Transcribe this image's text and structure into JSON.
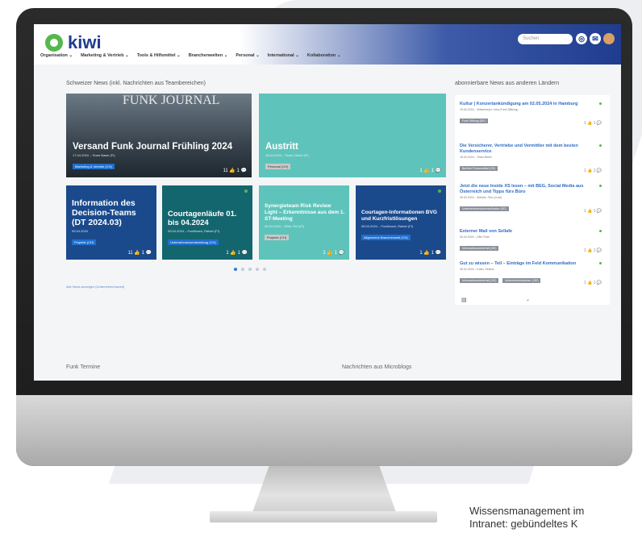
{
  "app": {
    "name": "kiwi"
  },
  "header": {
    "search_placeholder": "Suchen",
    "nav": [
      "Organisation ⌄",
      "Marketing & Vertrieb ⌄",
      "Tools & Hilfsmittel ⌄",
      "Branchenwelten ⌄",
      "Personal ⌄",
      "International ⌄",
      "Kollaboration ⌄"
    ]
  },
  "main": {
    "news_title": "Schweizer News (inkl. Nachrichten aus Teambereichen)",
    "featured": [
      {
        "title": "Versand Funk Journal Frühling 2024",
        "meta": "17.04.2024 – Team Basel (FI)",
        "tag": "Marketing & Vertrieb (CH)",
        "actions": "11 👍  1 💬",
        "image_text": "FUNK JOURNAL"
      },
      {
        "title": "Austritt",
        "meta": "18.04.2024 – Team Zürich (FI)",
        "tag": "Personal (CH)",
        "actions": "1 👍  1 💬"
      }
    ],
    "small_tiles": [
      {
        "title": "Information des Decision-Teams (DT 2024.03)",
        "meta": "09.04.2024",
        "tag": "Projekte (CH)",
        "actions": "11 👍  1 💬"
      },
      {
        "title": "Courtagenläufe 01. bis 04.2024",
        "meta": "09.04.2024 – Fuchlbach, Rafael (FI)",
        "tag": "Unternehmensentwicklung (CH)",
        "actions": "1 👍  1 💬"
      },
      {
        "title": "Synergieteam Risk Review Light – Erkenntnisse aus dem 1. ST-Meeting",
        "meta": "05.04.2024 – Elliot, Ruf (FI)",
        "tag": "Projekte (CH)",
        "actions": "1 👍  1 💬"
      },
      {
        "title": "Courtagen-Informationen BVG und Kurzfristlösungen",
        "meta": "08.04.2024 – Fuchlbach, Rafael (FI)",
        "tag": "Allgemeine Branchenwelt (CH)",
        "actions": "1 👍  1 💬"
      }
    ],
    "all_news_link": "Alle News anzeigen (Unternehmensweit)",
    "footer_left": "Funk Termine",
    "footer_right": "Nachrichten aus Microblogs"
  },
  "sidebar": {
    "title": "abonnierbare News aus anderen Ländern",
    "items": [
      {
        "title": "Kultur | Konzertankündigung am 02.05.2024 in Hamburg",
        "meta": "15.04.2024 – Wintemeyer, Ines (Funk Stiftung)",
        "tag": "Funk Stiftung (DE)",
        "actions": "1 👍  1 💬"
      },
      {
        "title": "Die Versicherer, Vertriebe und Vermittler mit dem besten Kundenservice",
        "meta": "18.04.2024 – Team Berlin",
        "tag": "Berliner Presseartikel (DE)",
        "actions": "1 👍  1 💬"
      },
      {
        "title": "Jetzt die neue Inside XS lesen – mit BEG, Social Media aus Österreich und Tipps fürs Büro",
        "meta": "05.04.2024 – Meinke, Finn (Luxe)",
        "tag": "Unternehmenskommunikation (DE)",
        "actions": "1 👍  1 💬"
      },
      {
        "title": "Externer Mail von Sellafe",
        "meta": "05.04.2024 – Eller Ruth",
        "tag": "Informationssicherheit (DE)",
        "actions": "1 👍  1 💬"
      },
      {
        "title": "Gut zu wissen – Teil – Einträge im Feld Kommunikation",
        "meta": "05.04.2024 – Kash, Helena",
        "tag": "Informationssicherheit (DE)",
        "tag2": "Unternehmenskomm. (DE)",
        "actions": "1 👍  1 💬"
      }
    ]
  },
  "caption": {
    "line1": "Wissensmanagement im",
    "line2": "Intranet: gebündeltes K"
  },
  "colors": {
    "brand_blue": "#1f3c8f",
    "teal": "#5ec4bb",
    "dark_blue": "#1a4a8c",
    "dark_teal": "#14666e",
    "green": "#55b84c"
  }
}
